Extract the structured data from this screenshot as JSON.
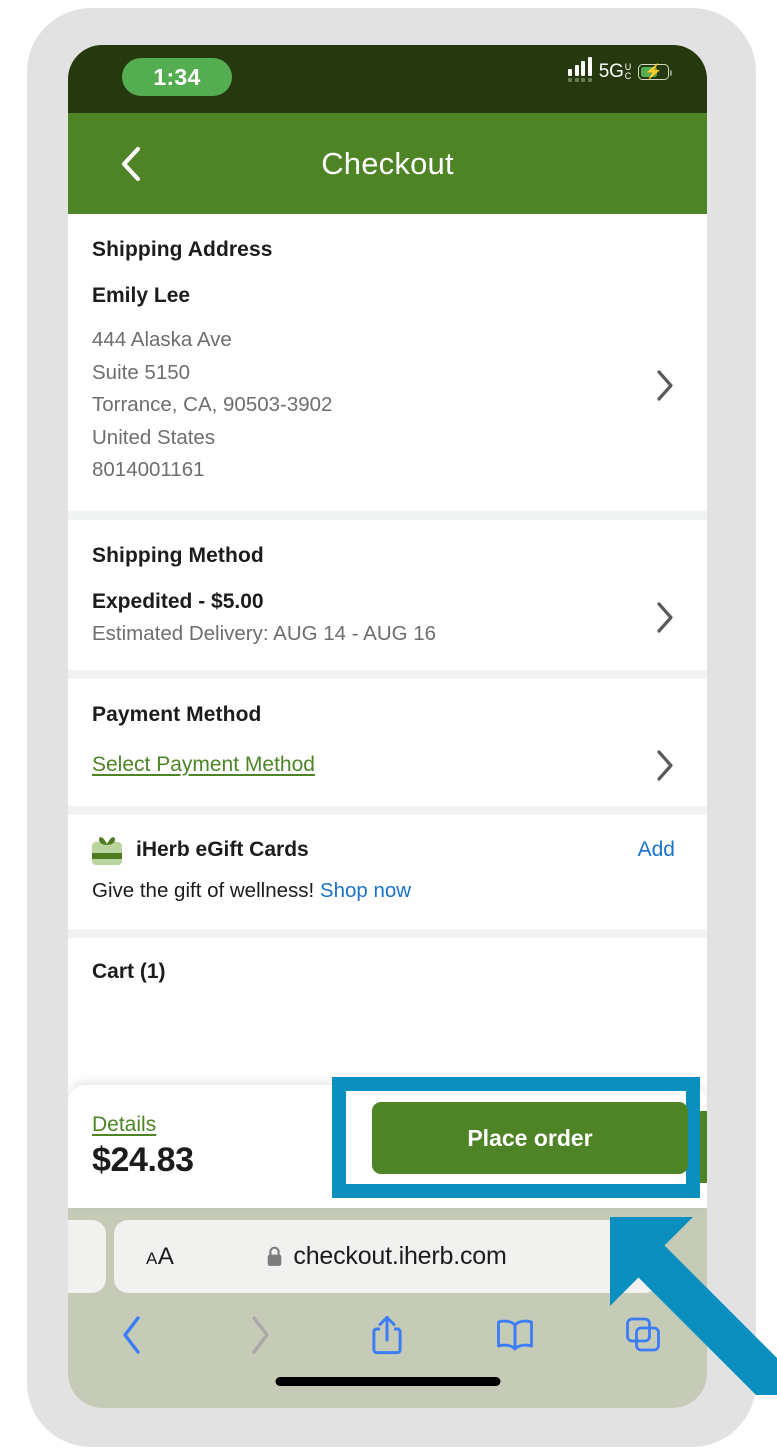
{
  "status_bar": {
    "time": "1:34",
    "network_label": "5G",
    "network_sub_top": "U",
    "network_sub_bottom": "C",
    "signal_icon": "cellular-signal-icon",
    "battery_icon": "battery-charging-icon"
  },
  "header": {
    "title": "Checkout",
    "back_icon": "chevron-left-icon"
  },
  "shipping_address": {
    "section_title": "Shipping Address",
    "recipient": "Emily Lee",
    "lines": [
      "444 Alaska Ave",
      "Suite 5150",
      "Torrance, CA, 90503-3902",
      "United States",
      "8014001161"
    ],
    "chevron_icon": "chevron-right-icon"
  },
  "shipping_method": {
    "section_title": "Shipping Method",
    "option": "Expedited - $5.00",
    "estimate": "Estimated Delivery: AUG 14 - AUG 16",
    "chevron_icon": "chevron-right-icon"
  },
  "payment_method": {
    "section_title": "Payment Method",
    "select_link": "Select Payment Method",
    "chevron_icon": "chevron-right-icon"
  },
  "gift_cards": {
    "icon": "gift-box-icon",
    "title": "iHerb eGift Cards",
    "add_label": "Add",
    "note_text": "Give the gift of wellness!",
    "note_link": "Shop now"
  },
  "cart": {
    "title": "Cart (1)"
  },
  "action_bar": {
    "details_label": "Details",
    "total": "$24.83",
    "place_order_label": "Place order"
  },
  "browser": {
    "text_size_small": "A",
    "text_size_big": "A",
    "lock_icon": "lock-icon",
    "url": "checkout.iherb.com",
    "toolbar": [
      {
        "name": "back-button",
        "icon": "chevron-left-icon",
        "enabled": true
      },
      {
        "name": "forward-button",
        "icon": "chevron-right-icon",
        "enabled": false
      },
      {
        "name": "share-button",
        "icon": "share-icon",
        "enabled": true
      },
      {
        "name": "bookmarks-button",
        "icon": "book-icon",
        "enabled": true
      },
      {
        "name": "tabs-button",
        "icon": "tabs-icon",
        "enabled": true
      }
    ]
  },
  "annotation": {
    "highlight_color": "#0b8fbf",
    "target_label": "Place order",
    "arrow_icon": "arrow-up-left-icon"
  },
  "colors": {
    "brand_green": "#4f8426",
    "status_bar_green": "#26380e",
    "time_pill_green": "#55ad52",
    "link_blue": "#1a73c8",
    "annotation_cyan": "#0b8fbf"
  }
}
